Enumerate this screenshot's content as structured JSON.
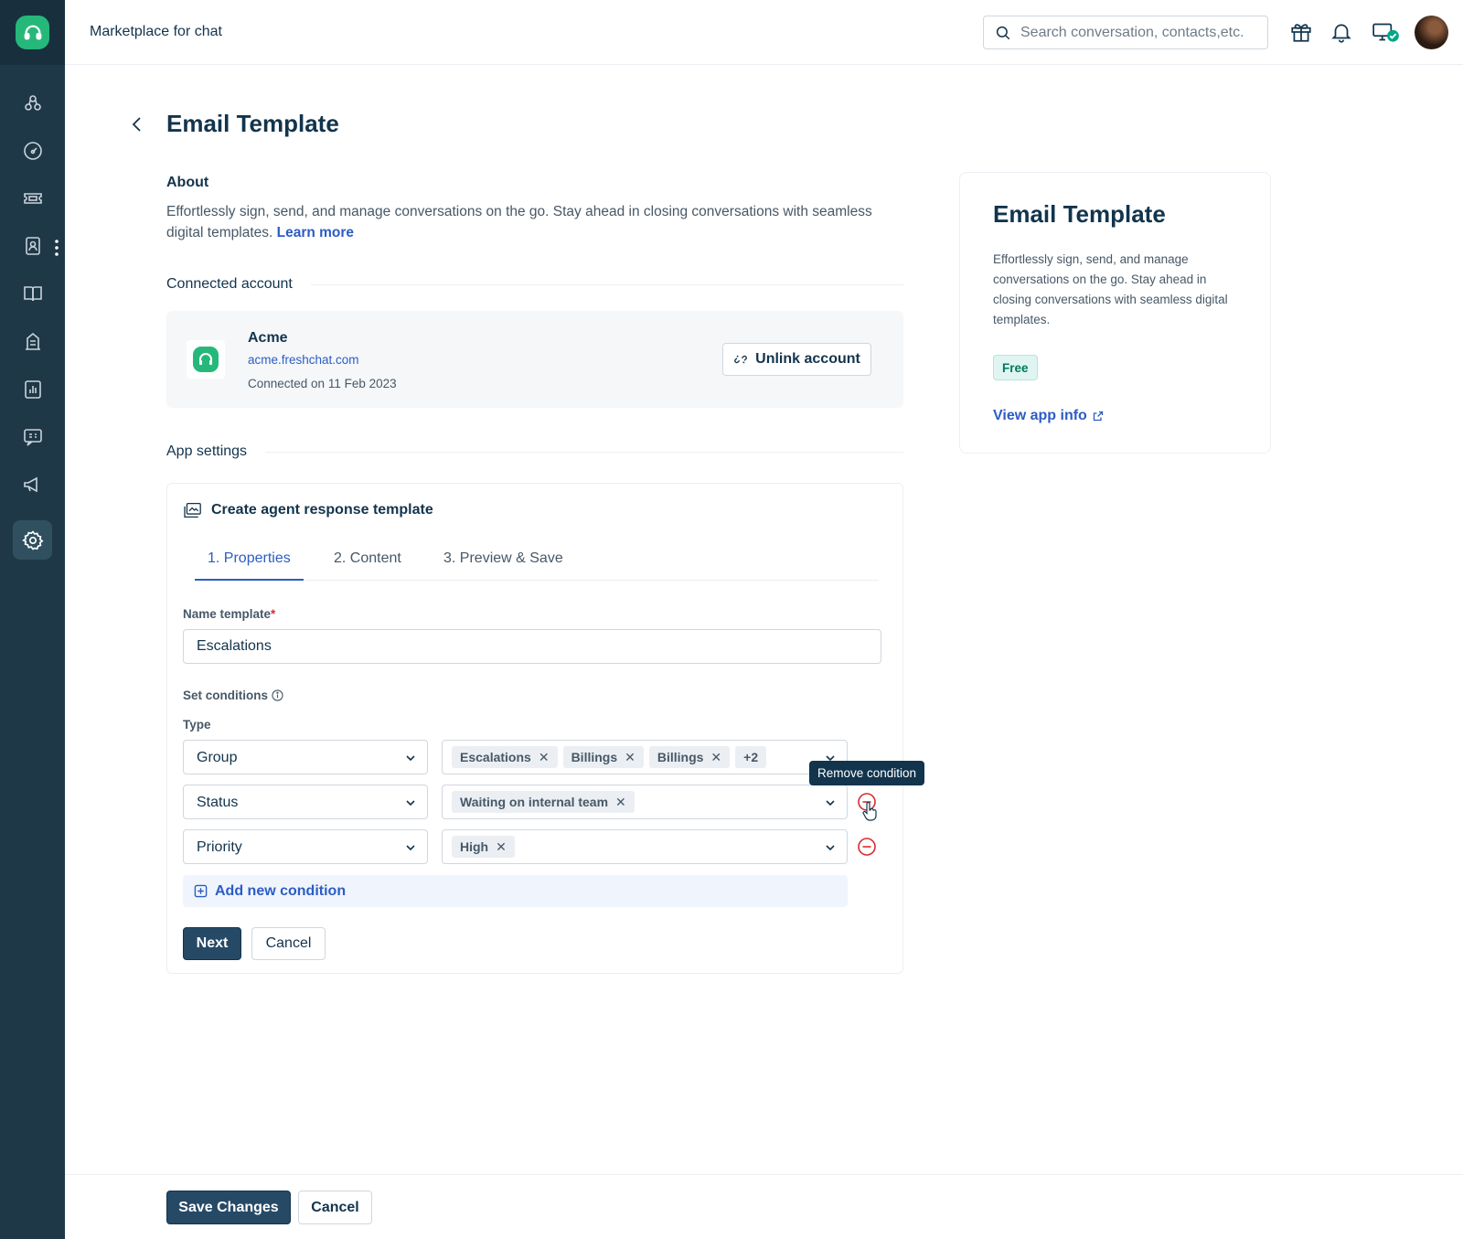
{
  "header": {
    "title": "Marketplace for chat",
    "search_placeholder": "Search conversation, contacts,etc."
  },
  "page": {
    "title": "Email Template",
    "about_heading": "About",
    "about_text": "Effortlessly sign, send, and manage conversations on the go. Stay ahead in closing conversations with seamless digital templates.",
    "learn_more": "Learn more"
  },
  "connected_account": {
    "section_label": "Connected account",
    "name": "Acme",
    "url": "acme.freshchat.com",
    "connected_on": "Connected on 11 Feb 2023",
    "unlink_label": "Unlink account"
  },
  "app_settings": {
    "section_label": "App settings",
    "card_title": "Create agent response template",
    "tabs": [
      {
        "label": "1. Properties"
      },
      {
        "label": "2. Content"
      },
      {
        "label": "3. Preview & Save"
      }
    ],
    "name_label": "Name template",
    "name_required_mark": "*",
    "name_value": "Escalations",
    "conditions_label": "Set conditions",
    "type_label": "Type",
    "conditions": [
      {
        "type": "Group",
        "values": [
          "Escalations",
          "Billings",
          "Billings"
        ],
        "more": "+2"
      },
      {
        "type": "Status",
        "values": [
          "Waiting on internal team"
        ]
      },
      {
        "type": "Priority",
        "values": [
          "High"
        ]
      }
    ],
    "chip_remove_glyph": "✕",
    "remove_tooltip": "Remove condition",
    "add_condition": "Add new condition",
    "next_label": "Next",
    "cancel_label": "Cancel"
  },
  "info_card": {
    "title": "Email Template",
    "description": "Effortlessly sign, send, and manage conversations on the go. Stay ahead in closing conversations with seamless digital templates.",
    "badge": "Free",
    "view_link": "View app info"
  },
  "footer": {
    "save_label": "Save Changes",
    "cancel_label": "Cancel"
  },
  "colors": {
    "sidebar": "#1f3847",
    "brand_green": "#26b87a",
    "link_blue": "#2c5cc5",
    "primary_button": "#264966",
    "danger_red": "#d72d30"
  },
  "icons": [
    "headset-icon",
    "contacts-icon",
    "dashboard-icon",
    "ticket-icon",
    "user-card-icon",
    "book-icon",
    "building-icon",
    "analytics-icon",
    "chat-icon",
    "megaphone-icon",
    "gear-icon",
    "search-icon",
    "gift-icon",
    "bell-icon",
    "monitor-status-icon",
    "back-chevron-icon",
    "unlink-icon",
    "template-icon",
    "info-icon",
    "chevron-down-icon",
    "minus-circle-icon",
    "plus-square-icon",
    "external-link-icon"
  ]
}
